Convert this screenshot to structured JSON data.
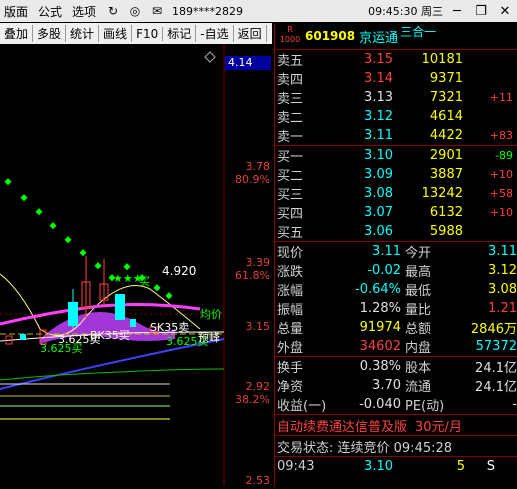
{
  "menu": {
    "items": [
      "版面",
      "公式",
      "选项"
    ],
    "account": "189****2829",
    "clock": "09:45:30 周三",
    "icons": [
      "refresh-icon",
      "user-icon",
      "mail-icon"
    ]
  },
  "toolbar": {
    "items": [
      "叠加",
      "多股",
      "统计",
      "画线",
      "F10",
      "标记",
      "-自选",
      "返回"
    ]
  },
  "chart": {
    "price_box": "4.14",
    "axis": [
      {
        "price": "3.78",
        "pct": "80.9%"
      },
      {
        "price": "3.39",
        "pct": "61.8%"
      },
      {
        "price": "3.15",
        "pct": ""
      },
      {
        "price": "2.92",
        "pct": "38.2%"
      },
      {
        "price": "2.53",
        "pct": ""
      }
    ],
    "annotations": {
      "high": "4.920",
      "buy_top": "买",
      "sell_signal": "SK35卖",
      "buy_signal": "BK35买",
      "low_sell": "3.625卖",
      "low_buy": "3.625买",
      "mid_buy": "3.625买",
      "balance": "均价",
      "warn": "预峰"
    }
  },
  "quote": {
    "code": "601908",
    "name": "京运通",
    "tag": "三合一",
    "r_label": "R",
    "r_num": "1000",
    "asks": [
      {
        "label": "卖五",
        "price": "3.15",
        "vol": "10181",
        "chg": ""
      },
      {
        "label": "卖四",
        "price": "3.14",
        "vol": "9371",
        "chg": ""
      },
      {
        "label": "卖三",
        "price": "3.13",
        "vol": "7321",
        "chg": "+11"
      },
      {
        "label": "卖二",
        "price": "3.12",
        "vol": "4614",
        "chg": ""
      },
      {
        "label": "卖一",
        "price": "3.11",
        "vol": "4422",
        "chg": "+83"
      }
    ],
    "bids": [
      {
        "label": "买一",
        "price": "3.10",
        "vol": "2901",
        "chg": "-89"
      },
      {
        "label": "买二",
        "price": "3.09",
        "vol": "3887",
        "chg": "+10"
      },
      {
        "label": "买三",
        "price": "3.08",
        "vol": "13242",
        "chg": "+58"
      },
      {
        "label": "买四",
        "price": "3.07",
        "vol": "6132",
        "chg": "+10"
      },
      {
        "label": "买五",
        "price": "3.06",
        "vol": "5988",
        "chg": ""
      }
    ],
    "stats": [
      {
        "l1": "现价",
        "v1": "3.11",
        "c1": "white",
        "l2": "今开",
        "v2": "3.11",
        "c2": "yellow"
      },
      {
        "l1": "涨跌",
        "v1": "-0.02",
        "c1": "white",
        "l2": "最高",
        "v2": "3.12",
        "c2": "yellow"
      },
      {
        "l1": "涨幅",
        "v1": "-0.64%",
        "c1": "white",
        "l2": "最低",
        "v2": "3.08",
        "c2": "yellow"
      },
      {
        "l1": "振幅",
        "v1": "1.28%",
        "c1": "white",
        "l2": "量比",
        "v2": "1.21",
        "c2": "red"
      },
      {
        "l1": "总量",
        "v1": "91974",
        "c1": "yellow",
        "l2": "总额",
        "v2": "2846万",
        "c2": "yellow"
      },
      {
        "l1": "外盘",
        "v1": "34602",
        "c1": "red",
        "l2": "内盘",
        "v2": "57372",
        "c2": "yellow"
      },
      {
        "l1": "换手",
        "v1": "0.38%",
        "c1": "white",
        "l2": "股本",
        "v2": "24.1亿",
        "c2": "white"
      },
      {
        "l1": "净资",
        "v1": "3.70",
        "c1": "white",
        "l2": "流通",
        "v2": "24.1亿",
        "c2": "white"
      },
      {
        "l1": "收益(一)",
        "v1": "-0.040",
        "c1": "white",
        "l2": "PE(动)",
        "v2": "-",
        "c2": "white"
      }
    ],
    "ad_text": "自动续费通达信普及版",
    "ad_price": "30元/月",
    "status_text": "交易状态: 连续竞价 09:45:28",
    "tick": {
      "time": "09:43",
      "price": "3.10",
      "vol": "5",
      "dir": "S"
    }
  },
  "colors": {
    "up": "#ff4040",
    "down": "#00ff00",
    "volume": "#ffff00",
    "name": "#00ffff",
    "border": "#800000"
  }
}
